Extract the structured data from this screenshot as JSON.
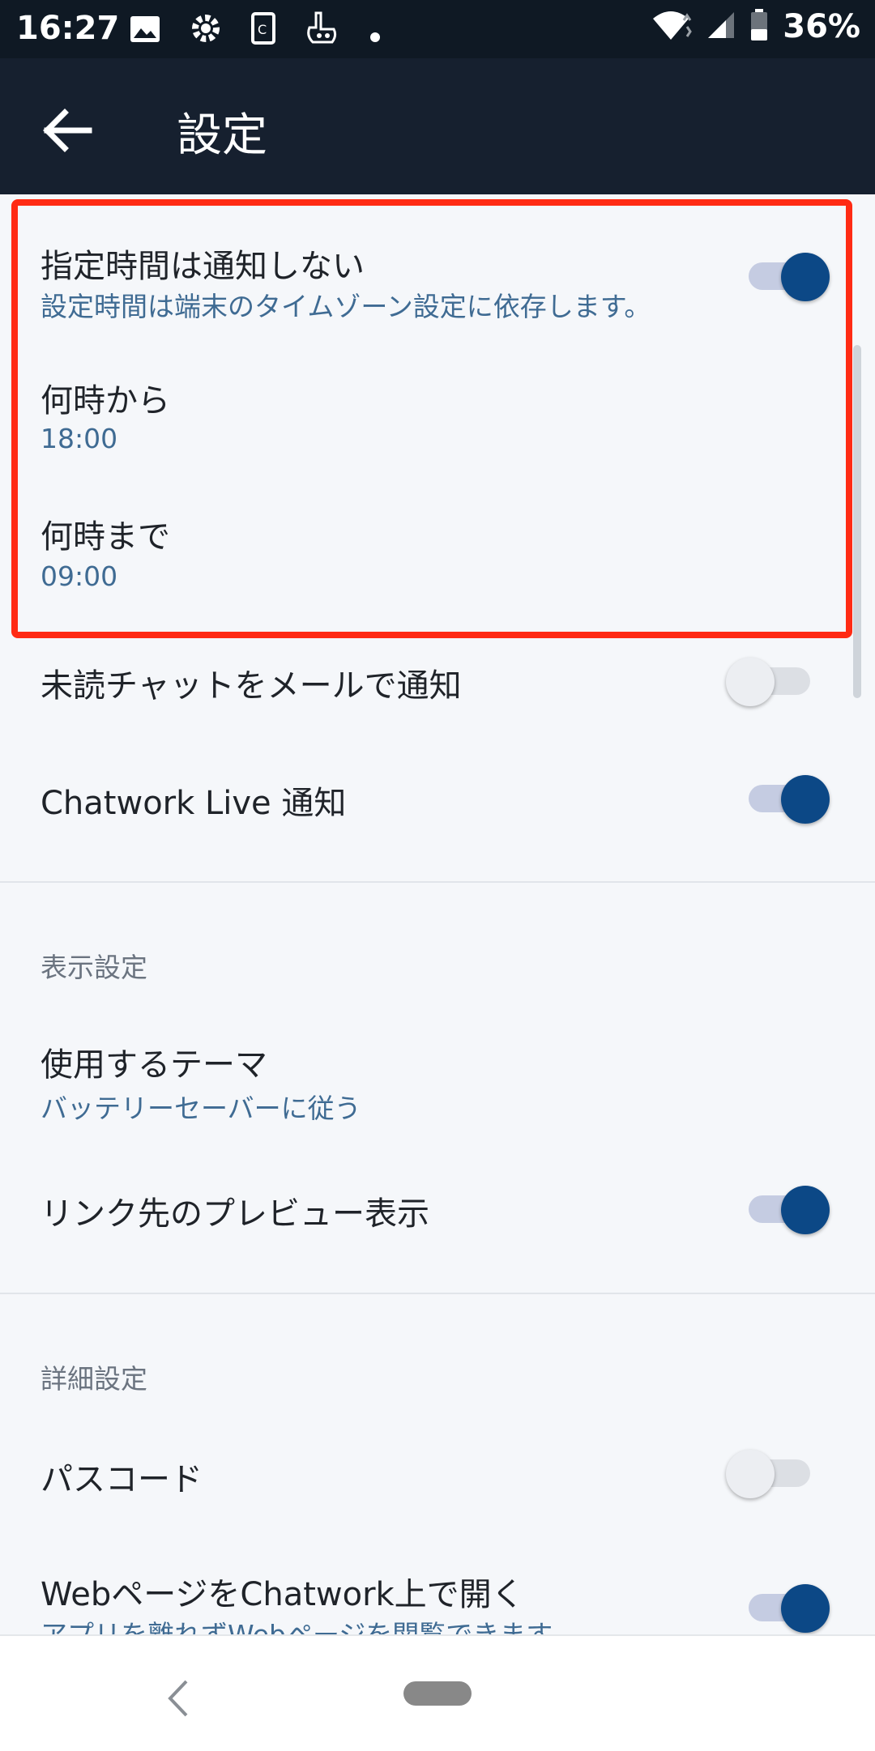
{
  "status_bar": {
    "time": "16:27",
    "battery_percent": "36%",
    "icons": [
      "gallery-icon",
      "gear-icon",
      "card-icon",
      "hand-icon",
      "dot-icon",
      "wifi-icon",
      "signal-icon",
      "battery-icon"
    ]
  },
  "appbar": {
    "title": "設定"
  },
  "notification": {
    "quiet_hours": {
      "title": "指定時間は通知しない",
      "subtitle": "設定時間は端末のタイムゾーン設定に依存します。",
      "enabled": true
    },
    "from": {
      "title": "何時から",
      "value": "18:00"
    },
    "until": {
      "title": "何時まで",
      "value": "09:00"
    },
    "unread_mail": {
      "title": "未読チャットをメールで通知",
      "enabled": false
    },
    "live": {
      "title": "Chatwork Live 通知",
      "enabled": true
    }
  },
  "display": {
    "header": "表示設定",
    "theme": {
      "title": "使用するテーマ",
      "value": "バッテリーセーバーに従う"
    },
    "link_preview": {
      "title": "リンク先のプレビュー表示",
      "enabled": true
    }
  },
  "advanced": {
    "header": "詳細設定",
    "passcode": {
      "title": "パスコード",
      "enabled": false
    },
    "webpage": {
      "title": "WebページをChatwork上で開く",
      "subtitle": "アプリを離れずWebページを閲覧できます",
      "enabled": true
    }
  },
  "colors": {
    "accent": "#0c4886",
    "highlight": "#ff2b14",
    "appbar": "#16202f",
    "subtitle": "#3f6b93"
  }
}
